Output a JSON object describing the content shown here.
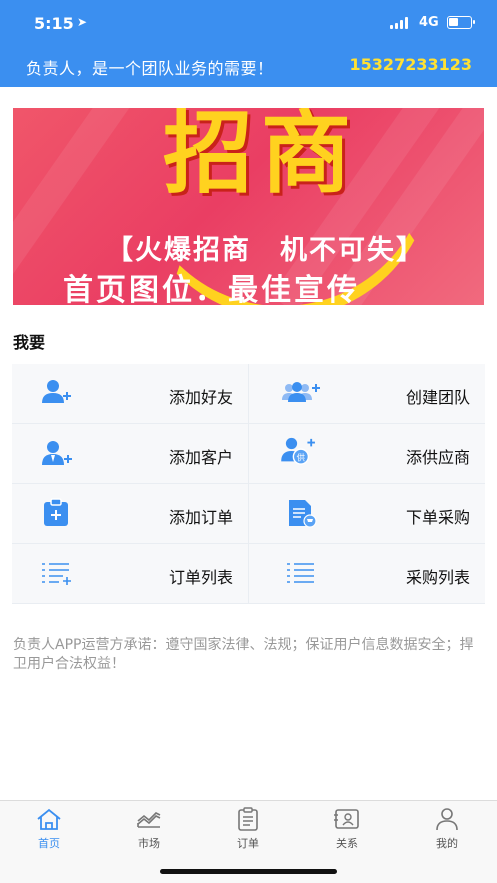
{
  "status_bar": {
    "time": "5:15",
    "network": "4G"
  },
  "header": {
    "slogan": "负责人，是一个团队业务的需要！",
    "phone": "15327233123"
  },
  "banner": {
    "big_text": "招商",
    "line1": "【火爆招商　机不可失】",
    "line2": "首页图位．最佳宣传"
  },
  "section": {
    "title": "我要"
  },
  "actions": [
    {
      "label": "添加好友",
      "icon": "add-friend-icon"
    },
    {
      "label": "创建团队",
      "icon": "create-team-icon"
    },
    {
      "label": "添加客户",
      "icon": "add-customer-icon"
    },
    {
      "label": "添供应商",
      "icon": "add-supplier-icon"
    },
    {
      "label": "添加订单",
      "icon": "add-order-icon"
    },
    {
      "label": "下单采购",
      "icon": "purchase-order-icon"
    },
    {
      "label": "订单列表",
      "icon": "order-list-icon"
    },
    {
      "label": "采购列表",
      "icon": "purchase-list-icon"
    }
  ],
  "notice": "负责人APP运营方承诺：遵守国家法律、法规；保证用户信息数据安全；捍卫用户合法权益！",
  "tabs": [
    {
      "label": "首页",
      "icon": "home-icon",
      "active": true
    },
    {
      "label": "市场",
      "icon": "market-icon",
      "active": false
    },
    {
      "label": "订单",
      "icon": "order-icon",
      "active": false
    },
    {
      "label": "关系",
      "icon": "contacts-icon",
      "active": false
    },
    {
      "label": "我的",
      "icon": "profile-icon",
      "active": false
    }
  ],
  "colors": {
    "primary": "#3b8ff0",
    "phone": "#ffe133",
    "banner": "#ea3e63",
    "icon": "#3b8ff0"
  },
  "supplier_icon_text": "供"
}
